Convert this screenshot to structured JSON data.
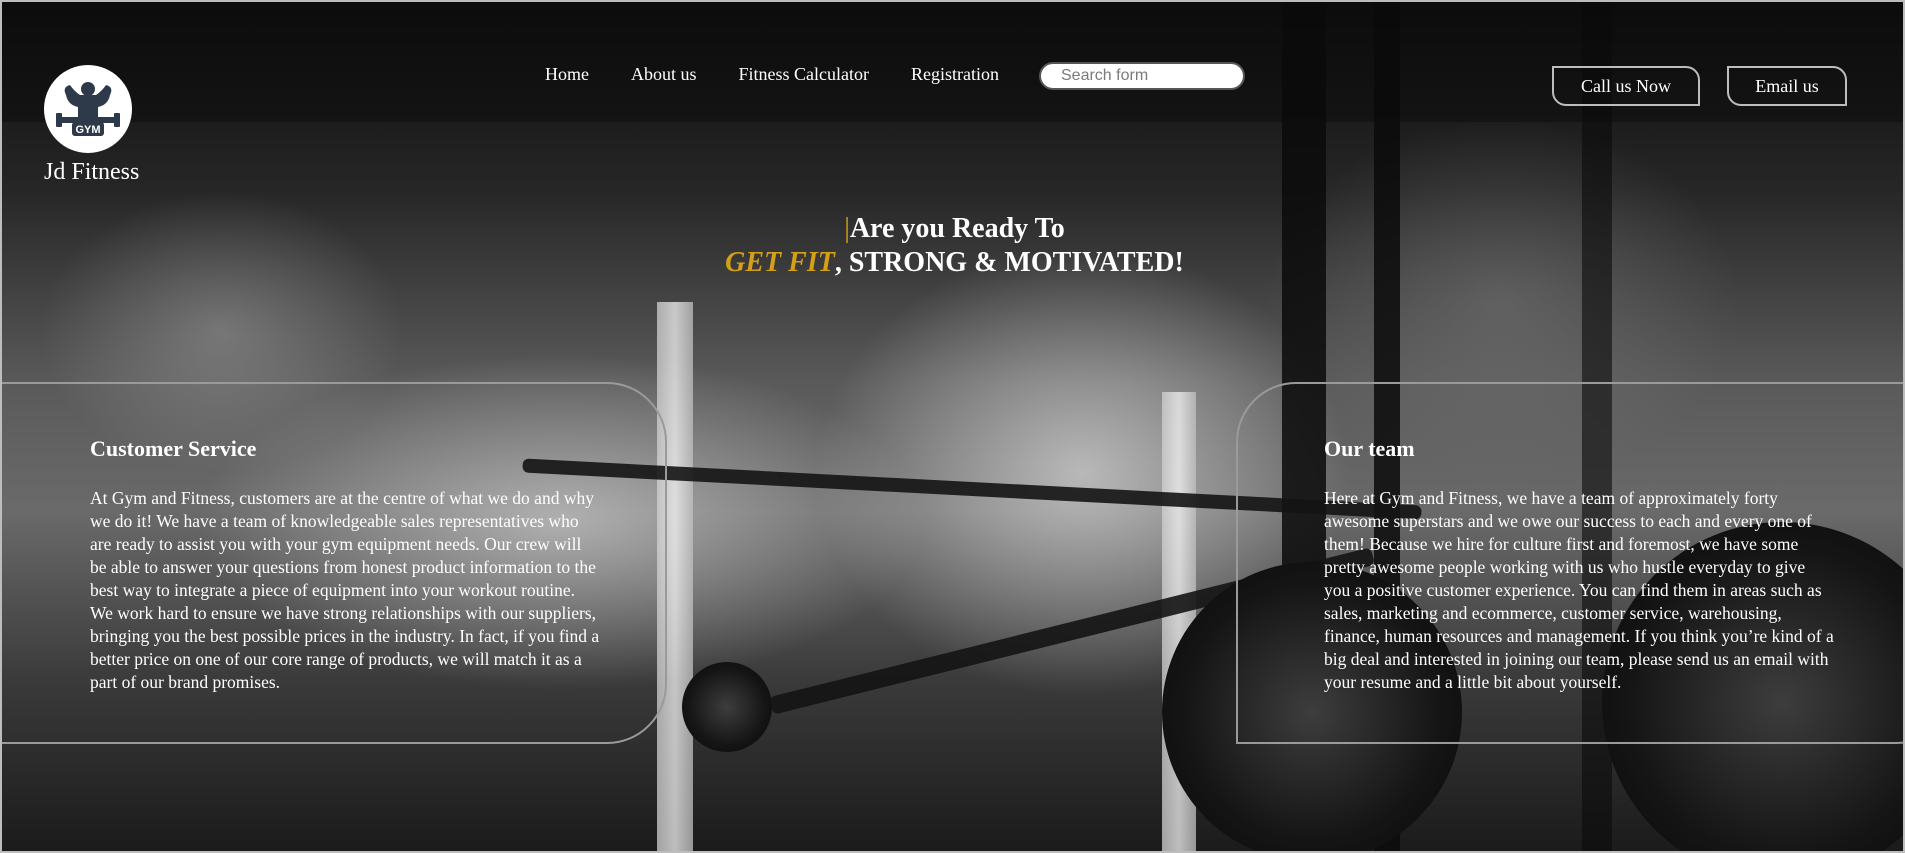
{
  "brand": {
    "name": "Jd Fitness",
    "logo_text": "GYM"
  },
  "nav": {
    "items": [
      {
        "label": "Home"
      },
      {
        "label": "About us"
      },
      {
        "label": "Fitness Calculator"
      },
      {
        "label": "Registration"
      }
    ],
    "search_placeholder": "Search form"
  },
  "actions": {
    "call_label": "Call us Now",
    "email_label": "Email us"
  },
  "hero": {
    "cursor": "|",
    "line1": "Are you Ready To",
    "accent": "GET FIT",
    "line2_rest": ", STRONG & MOTIVATED!"
  },
  "cards": {
    "customer_service": {
      "title": "Customer Service",
      "body": "At Gym and Fitness, customers are at the centre of what we do and why we do it! We have a team of knowledgeable sales representatives who are ready to assist you with your gym equipment needs. Our crew will be able to answer your questions from honest product information to the best way to integrate a piece of equipment into your workout routine. We work hard to ensure we have strong relationships with our suppliers, bringing you the best possible prices in the industry. In fact, if you find a better price on one of our core range of products, we will match it as a part of our brand promises."
    },
    "our_team": {
      "title": "Our team",
      "body": "Here at Gym and Fitness, we have a team of approximately forty awesome superstars and we owe our success to each and every one of them! Because we hire for culture first and foremost, we have some pretty awesome people working with us who hustle everyday to give you a positive customer experience. You can find them in areas such as sales, marketing and ecommerce, customer service, warehousing, finance, human resources and management. If you think you’re kind of a big deal and interested in joining our team, please send us an email with your resume and a little bit about yourself."
    }
  },
  "colors": {
    "accent": "#d4a017",
    "text": "#ffffff",
    "border": "#9a9a9a"
  }
}
